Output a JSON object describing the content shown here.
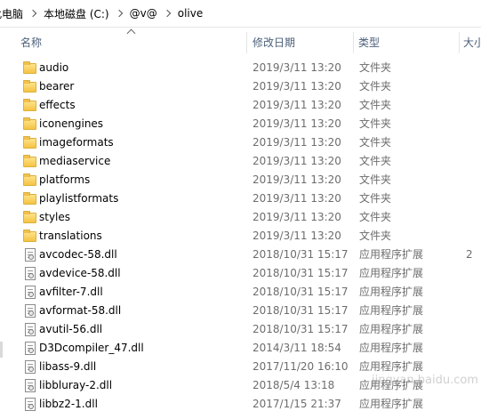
{
  "breadcrumb": [
    "此电脑",
    "本地磁盘 (C:)",
    "@v@",
    "olive"
  ],
  "columns": {
    "name": "名称",
    "date": "修改日期",
    "type": "类型",
    "size": "大小"
  },
  "files": [
    {
      "name": "audio",
      "date": "2019/3/11 13:20",
      "type": "文件夹",
      "size": "",
      "kind": "folder"
    },
    {
      "name": "bearer",
      "date": "2019/3/11 13:20",
      "type": "文件夹",
      "size": "",
      "kind": "folder"
    },
    {
      "name": "effects",
      "date": "2019/3/11 13:20",
      "type": "文件夹",
      "size": "",
      "kind": "folder"
    },
    {
      "name": "iconengines",
      "date": "2019/3/11 13:20",
      "type": "文件夹",
      "size": "",
      "kind": "folder"
    },
    {
      "name": "imageformats",
      "date": "2019/3/11 13:20",
      "type": "文件夹",
      "size": "",
      "kind": "folder"
    },
    {
      "name": "mediaservice",
      "date": "2019/3/11 13:20",
      "type": "文件夹",
      "size": "",
      "kind": "folder"
    },
    {
      "name": "platforms",
      "date": "2019/3/11 13:20",
      "type": "文件夹",
      "size": "",
      "kind": "folder"
    },
    {
      "name": "playlistformats",
      "date": "2019/3/11 13:20",
      "type": "文件夹",
      "size": "",
      "kind": "folder"
    },
    {
      "name": "styles",
      "date": "2019/3/11 13:20",
      "type": "文件夹",
      "size": "",
      "kind": "folder"
    },
    {
      "name": "translations",
      "date": "2019/3/11 13:20",
      "type": "文件夹",
      "size": "",
      "kind": "folder"
    },
    {
      "name": "avcodec-58.dll",
      "date": "2018/10/31 15:17",
      "type": "应用程序扩展",
      "size": "2",
      "kind": "dll"
    },
    {
      "name": "avdevice-58.dll",
      "date": "2018/10/31 15:17",
      "type": "应用程序扩展",
      "size": "",
      "kind": "dll"
    },
    {
      "name": "avfilter-7.dll",
      "date": "2018/10/31 15:17",
      "type": "应用程序扩展",
      "size": "",
      "kind": "dll"
    },
    {
      "name": "avformat-58.dll",
      "date": "2018/10/31 15:17",
      "type": "应用程序扩展",
      "size": "",
      "kind": "dll"
    },
    {
      "name": "avutil-56.dll",
      "date": "2018/10/31 15:17",
      "type": "应用程序扩展",
      "size": "",
      "kind": "dll"
    },
    {
      "name": "D3Dcompiler_47.dll",
      "date": "2014/3/11 18:54",
      "type": "应用程序扩展",
      "size": "",
      "kind": "dll"
    },
    {
      "name": "libass-9.dll",
      "date": "2017/11/20 16:10",
      "type": "应用程序扩展",
      "size": "",
      "kind": "dll"
    },
    {
      "name": "libbluray-2.dll",
      "date": "2018/5/4 13:18",
      "type": "应用程序扩展",
      "size": "",
      "kind": "dll"
    },
    {
      "name": "libbz2-1.dll",
      "date": "2017/1/15 21:37",
      "type": "应用程序扩展",
      "size": "",
      "kind": "dll"
    }
  ],
  "watermark": "jingyan.baidu.com",
  "colors": {
    "header_text": "#4c607a",
    "secondary_text": "#6d6d6d",
    "folder": "#f5c342"
  }
}
